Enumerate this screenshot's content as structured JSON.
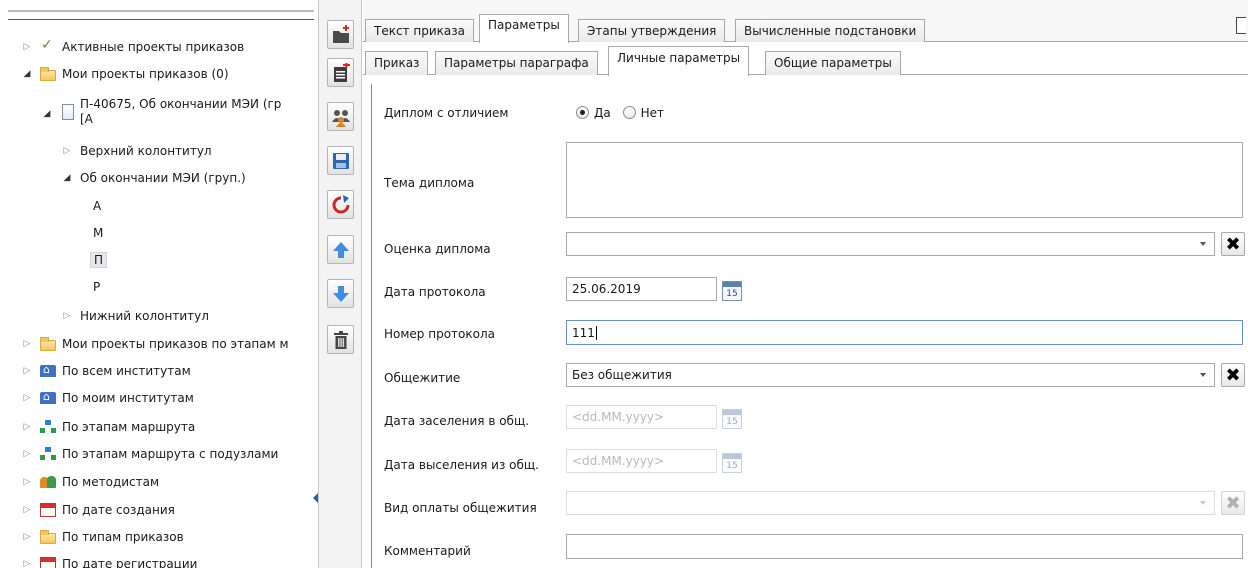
{
  "tree": {
    "items": [
      {
        "label": "Активные проекты приказов",
        "icon": "check-icon",
        "expanded": false
      },
      {
        "label": "Мои проекты приказов (0)",
        "icon": "folder-icon",
        "expanded": true
      },
      {
        "label": "П-40675, Об окончании МЭИ (гр",
        "label2": "[А",
        "icon": "document-icon",
        "expanded": true
      },
      {
        "label": "Верхний колонтитул",
        "expanded": false
      },
      {
        "label": "Об окончании МЭИ (груп.)",
        "expanded": true
      },
      {
        "label": "А"
      },
      {
        "label": "М"
      },
      {
        "label": "П"
      },
      {
        "label": "Р"
      },
      {
        "label": "Нижний колонтитул",
        "expanded": false
      },
      {
        "label": "Мои проекты приказов по этапам м",
        "icon": "folder-icon",
        "expanded": false
      },
      {
        "label": "По всем институтам",
        "icon": "institution-icon",
        "expanded": false
      },
      {
        "label": "По моим институтам",
        "icon": "institution-icon",
        "expanded": false
      },
      {
        "label": "По этапам маршрута",
        "icon": "route-icon",
        "expanded": false
      },
      {
        "label": "По этапам маршрута с подузлами",
        "icon": "route-icon",
        "expanded": false
      },
      {
        "label": "По методистам",
        "icon": "people-icon",
        "expanded": false
      },
      {
        "label": "По дате создания",
        "icon": "calendar-icon",
        "expanded": false
      },
      {
        "label": "По типам приказов",
        "icon": "folder-icon",
        "expanded": false
      },
      {
        "label": "По дате регистрации",
        "icon": "calendar-icon",
        "expanded": false
      }
    ]
  },
  "toolbar": {
    "buttons": [
      "new-folder-icon",
      "add-document-icon",
      "users-icon",
      "save-icon",
      "refresh-icon",
      "arrow-up-icon",
      "arrow-down-icon",
      "trash-icon"
    ]
  },
  "tabs": {
    "main": [
      "Текст приказа",
      "Параметры",
      "Этапы утверждения",
      "Вычисленные подстановки"
    ],
    "main_active": "Параметры",
    "sub": [
      "Приказ",
      "Параметры параграфа",
      "Личные параметры",
      "Общие параметры"
    ],
    "sub_active": "Личные параметры"
  },
  "form": {
    "diploma_honors": {
      "label": "Диплом с отличием",
      "options": [
        "Да",
        "Нет"
      ],
      "selected": "Да"
    },
    "diploma_topic": {
      "label": "Тема диплома",
      "value": ""
    },
    "diploma_grade": {
      "label": "Оценка диплома",
      "value": ""
    },
    "protocol_date": {
      "label": "Дата протокола",
      "value": "25.06.2019",
      "calendar_day": "15"
    },
    "protocol_number": {
      "label": "Номер протокола",
      "value": "111"
    },
    "dormitory": {
      "label": "Общежитие",
      "value": "Без общежития"
    },
    "dorm_checkin": {
      "label": "Дата заселения в общ.",
      "placeholder": "<dd.MM.yyyy>",
      "calendar_day": "15"
    },
    "dorm_checkout": {
      "label": "Дата выселения из общ.",
      "placeholder": "<dd.MM.yyyy>",
      "calendar_day": "15"
    },
    "dorm_payment": {
      "label": "Вид оплаты общежития",
      "value": ""
    },
    "comment": {
      "label": "Комментарий",
      "value": ""
    }
  },
  "colors": {
    "accent": "#2a5db0",
    "border": "#a9a9a9",
    "disabled": "#b9b9b9"
  }
}
